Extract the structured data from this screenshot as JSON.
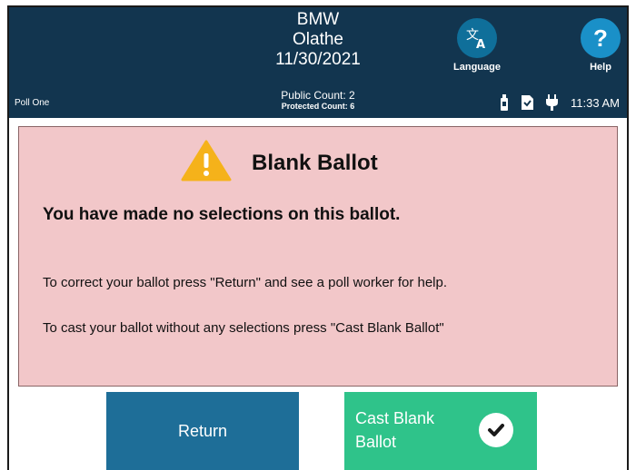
{
  "header": {
    "election_name": "BMW",
    "location": "Olathe",
    "date": "11/30/2021",
    "language_label": "Language",
    "help_label": "Help",
    "help_glyph": "?",
    "poll_name": "Poll One",
    "public_count": "Public Count: 2",
    "protected_count": "Protected Count: 6",
    "time": "11:33 AM"
  },
  "dialog": {
    "title": "Blank Ballot",
    "headline": "You have made no selections on this ballot.",
    "line1": "To correct your ballot press \"Return\" and see a poll worker for help.",
    "line2": "To cast your ballot without any selections press \"Cast Blank Ballot\""
  },
  "buttons": {
    "return_label": "Return",
    "cast_label": "Cast Blank Ballot"
  },
  "colors": {
    "header_bg": "#12354f",
    "dialog_bg": "#f2c7c9",
    "return_bg": "#1e6e98",
    "cast_bg": "#2fc38a",
    "warning": "#f5b21a"
  },
  "icons": {
    "language": "translate-icon",
    "help": "question-icon",
    "status": [
      "usb-drive-icon",
      "document-icon",
      "power-plug-icon"
    ],
    "warning": "warning-triangle-icon",
    "cast": "checkmark-icon"
  }
}
